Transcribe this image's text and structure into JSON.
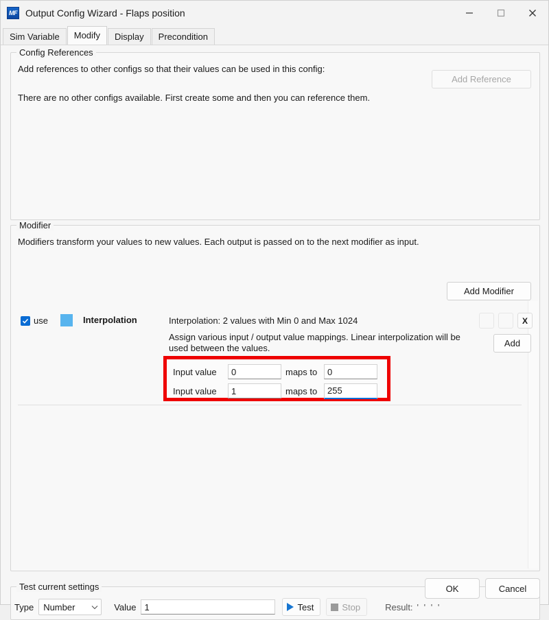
{
  "window": {
    "title": "Output Config Wizard - Flaps position",
    "icon": "mf-app-icon",
    "icon_text": "MF",
    "controls": {
      "minimize": "minimize-icon",
      "maximize": "maximize-icon",
      "close": "close-icon"
    }
  },
  "tabs": [
    {
      "label": "Sim Variable",
      "selected": false
    },
    {
      "label": "Modify",
      "selected": true
    },
    {
      "label": "Display",
      "selected": false
    },
    {
      "label": "Precondition",
      "selected": false
    }
  ],
  "config_references": {
    "group_title": "Config References",
    "description": "Add references to other configs so that their values can be used in this config:",
    "empty_message": "There are no other configs available. First create some and then you can reference them.",
    "add_button": "Add Reference",
    "add_button_disabled": true
  },
  "modifier": {
    "group_title": "Modifier",
    "description": "Modifiers transform your values to new values. Each output is passed on to the next modifier as input.",
    "add_button": "Add Modifier",
    "row": {
      "use_label": "use",
      "use_checked": true,
      "swatch_color": "#58b4ee",
      "name": "Interpolation",
      "summary": "Interpolation: 2 values with Min 0 and Max 1024",
      "move_up_button": "",
      "move_down_button": "",
      "remove_button": "X"
    },
    "assign_description": "Assign various input / output value mappings. Linear interpolization will be used between the values.",
    "add_mapping_button": "Add",
    "mappings": [
      {
        "input_label": "Input value",
        "input_value": "0",
        "maps_label": "maps to",
        "output_value": "0",
        "focused": false
      },
      {
        "input_label": "Input value",
        "input_value": "1",
        "maps_label": "maps to",
        "output_value": "255",
        "focused": true
      }
    ],
    "highlight_color": "#ee0000"
  },
  "test": {
    "group_title": "Test current settings",
    "type_label": "Type",
    "type_value": "Number",
    "value_label": "Value",
    "value_input": "1",
    "test_button": "Test",
    "stop_button": "Stop",
    "stop_disabled": true,
    "result_label": "Result:",
    "result_value": "' ' ' '"
  },
  "footer": {
    "ok_button": "OK",
    "cancel_button": "Cancel"
  }
}
